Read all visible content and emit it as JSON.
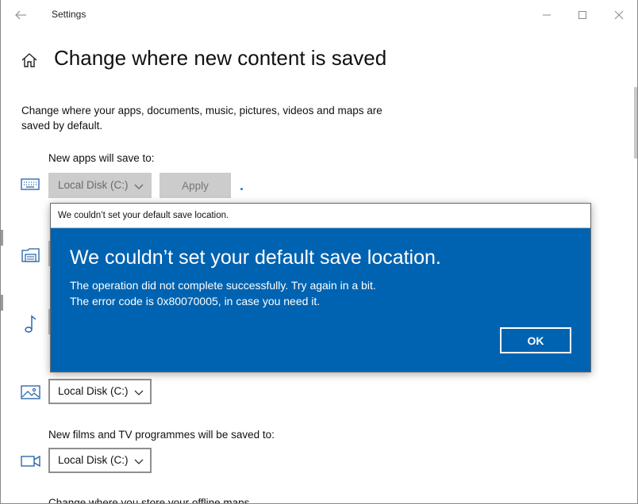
{
  "window": {
    "title": "Settings",
    "back_icon": "arrow-left-icon",
    "controls": [
      "minimize-icon",
      "maximize-icon",
      "close-icon"
    ]
  },
  "page": {
    "home_icon": "home-icon",
    "title": "Change where new content is saved",
    "description": "Change where your apps, documents, music, pictures, videos and maps are saved by default."
  },
  "sections": {
    "apps": {
      "label": "New apps will save to:",
      "icon": "keyboard-icon",
      "drive": "Local Disk (C:)",
      "apply_label": "Apply",
      "state": "disabled"
    },
    "documents": {
      "icon": "document-folder-icon"
    },
    "music": {
      "icon": "music-note-icon"
    },
    "photos": {
      "icon": "picture-icon",
      "drive": "Local Disk (C:)"
    },
    "films": {
      "label": "New films and TV programmes will be saved to:",
      "icon": "video-camera-icon",
      "drive": "Local Disk (C:)"
    },
    "offline_maps": {
      "label": "Change where you store your offline maps"
    }
  },
  "dialog": {
    "window_title": "We couldn’t set your default save location.",
    "heading": "We couldn’t set your default save location.",
    "message_line1": "The operation did not complete successfully. Try again in a bit.",
    "message_line2": "The error code is 0x80070005, in case you need it.",
    "ok_label": "OK",
    "background_color": "#0063b1"
  }
}
